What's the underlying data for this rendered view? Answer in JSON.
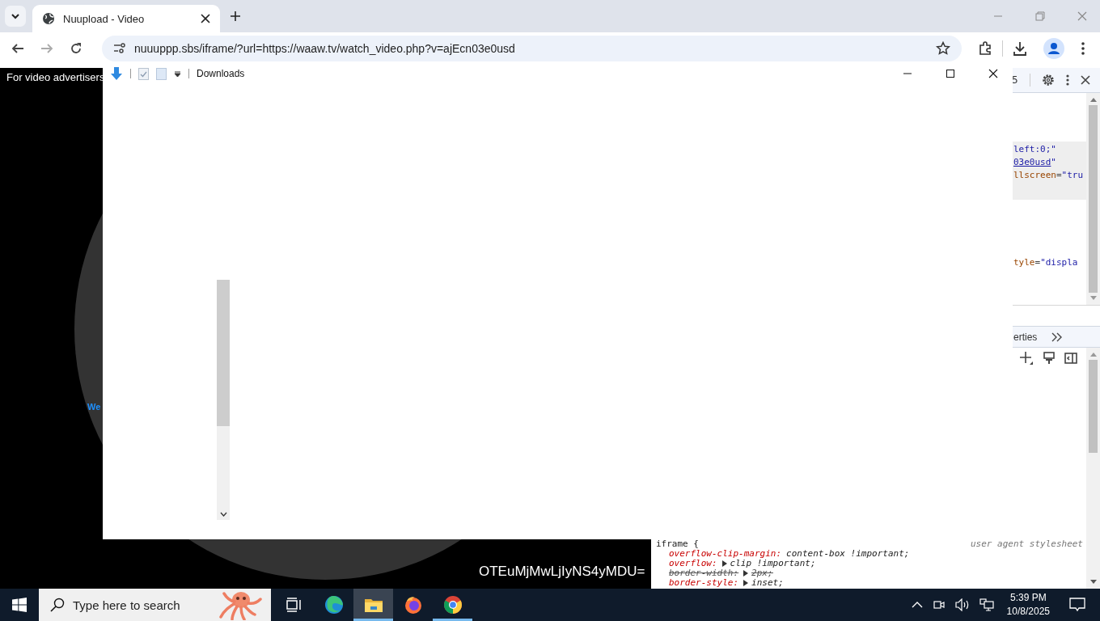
{
  "browser": {
    "tabs": [
      {
        "title": "Nuupload - Video",
        "selected": true
      }
    ],
    "address": "nuuuppp.sbs/iframe/?url=https://waaw.tv/watch_video.php?v=ajEcn03e0usd"
  },
  "page": {
    "banner": "For video advertisers",
    "link_fragment": "We",
    "encoded_text": "OTEuMjMwLjIyNS4yMDU="
  },
  "downloads_window": {
    "title": "Downloads"
  },
  "devtools": {
    "issues_count": "5",
    "element_lines": [
      {
        "selected": true,
        "segments": [
          {
            "kind": "value",
            "text": "left:0;\""
          }
        ]
      },
      {
        "selected": true,
        "segments": [
          {
            "kind": "link",
            "text": "03e0usd"
          },
          {
            "kind": "value",
            "text": "\""
          }
        ]
      },
      {
        "selected": true,
        "segments": [
          {
            "kind": "attr",
            "text": "llscreen"
          },
          {
            "kind": "punct",
            "text": "="
          },
          {
            "kind": "value",
            "text": "\"tru"
          }
        ]
      },
      {
        "selected": false,
        "segments": [
          {
            "kind": "attr",
            "text": "tyle"
          },
          {
            "kind": "punct",
            "text": "="
          },
          {
            "kind": "value",
            "text": "\"displa"
          }
        ]
      }
    ],
    "side_tab": "erties",
    "styles_rule": {
      "selector": "iframe {",
      "origin": "user agent stylesheet",
      "declarations": [
        {
          "property": "overflow-clip-margin:",
          "value": "content-box !important;",
          "expandable": false,
          "overridden": false
        },
        {
          "property": "overflow:",
          "value": "clip !important;",
          "expandable": true,
          "overridden": false
        },
        {
          "property": "border-width:",
          "value": "2px;",
          "expandable": true,
          "overridden": true
        },
        {
          "property": "border-style:",
          "value": "inset;",
          "expandable": true,
          "overridden": false
        }
      ]
    }
  },
  "taskbar": {
    "search_placeholder": "Type here to search",
    "apps": [
      {
        "kind": "taskview",
        "selected": false,
        "running": false
      },
      {
        "kind": "edge",
        "selected": false,
        "running": false
      },
      {
        "kind": "explorer",
        "selected": true,
        "running": true
      },
      {
        "kind": "firefox",
        "selected": false,
        "running": false
      },
      {
        "kind": "chrome",
        "selected": false,
        "running": true
      }
    ],
    "time": "5:39 PM",
    "date": "10/8/2025"
  }
}
